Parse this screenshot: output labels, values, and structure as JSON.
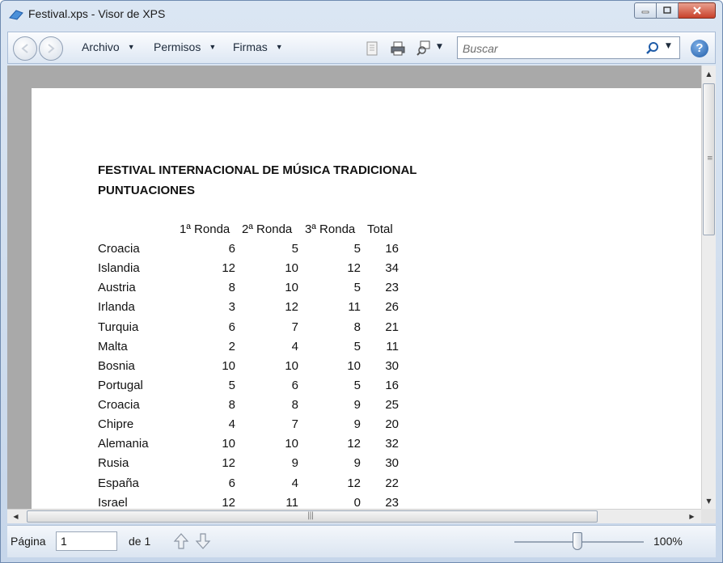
{
  "window": {
    "title": "Festival.xps - Visor de XPS"
  },
  "toolbar": {
    "menus": [
      {
        "label": "Archivo"
      },
      {
        "label": "Permisos"
      },
      {
        "label": "Firmas"
      }
    ],
    "search": {
      "placeholder": "Buscar",
      "value": ""
    },
    "help_label": "?"
  },
  "document": {
    "title": "FESTIVAL INTERNACIONAL DE MÚSICA TRADICIONAL",
    "subtitle": "PUNTUACIONES",
    "columns": [
      "1ª Ronda",
      "2ª Ronda",
      "3ª Ronda",
      "Total"
    ],
    "rows": [
      {
        "name": "Croacia",
        "r1": "6",
        "r2": "5",
        "r3": "5",
        "total": "16"
      },
      {
        "name": "Islandia",
        "r1": "12",
        "r2": "10",
        "r3": "12",
        "total": "34"
      },
      {
        "name": "Austria",
        "r1": "8",
        "r2": "10",
        "r3": "5",
        "total": "23"
      },
      {
        "name": "Irlanda",
        "r1": "3",
        "r2": "12",
        "r3": "11",
        "total": "26"
      },
      {
        "name": "Turquia",
        "r1": "6",
        "r2": "7",
        "r3": "8",
        "total": "21"
      },
      {
        "name": "Malta",
        "r1": "2",
        "r2": "4",
        "r3": "5",
        "total": "11"
      },
      {
        "name": "Bosnia",
        "r1": "10",
        "r2": "10",
        "r3": "10",
        "total": "30"
      },
      {
        "name": "Portugal",
        "r1": "5",
        "r2": "6",
        "r3": "5",
        "total": "16"
      },
      {
        "name": "Croacia",
        "r1": "8",
        "r2": "8",
        "r3": "9",
        "total": "25"
      },
      {
        "name": "Chipre",
        "r1": "4",
        "r2": "7",
        "r3": "9",
        "total": "20"
      },
      {
        "name": "Alemania",
        "r1": "10",
        "r2": "10",
        "r3": "12",
        "total": "32"
      },
      {
        "name": "Rusia",
        "r1": "12",
        "r2": "9",
        "r3": "9",
        "total": "30"
      },
      {
        "name": "España",
        "r1": "6",
        "r2": "4",
        "r3": "12",
        "total": "22"
      },
      {
        "name": "Israel",
        "r1": "12",
        "r2": "11",
        "r3": "0",
        "total": "23"
      }
    ]
  },
  "status": {
    "page_label": "Página",
    "page_value": "1",
    "of_label": "de 1",
    "zoom_label": "100%"
  },
  "colors": {
    "accent": "#1f5ca8",
    "close_button": "#c8412b",
    "doc_background": "#a9a9a9"
  },
  "icons": [
    "app-icon",
    "back-icon",
    "forward-icon",
    "document-icon",
    "printer-icon",
    "zoom-icon",
    "search-icon",
    "help-icon",
    "page-up-icon",
    "page-down-icon"
  ]
}
